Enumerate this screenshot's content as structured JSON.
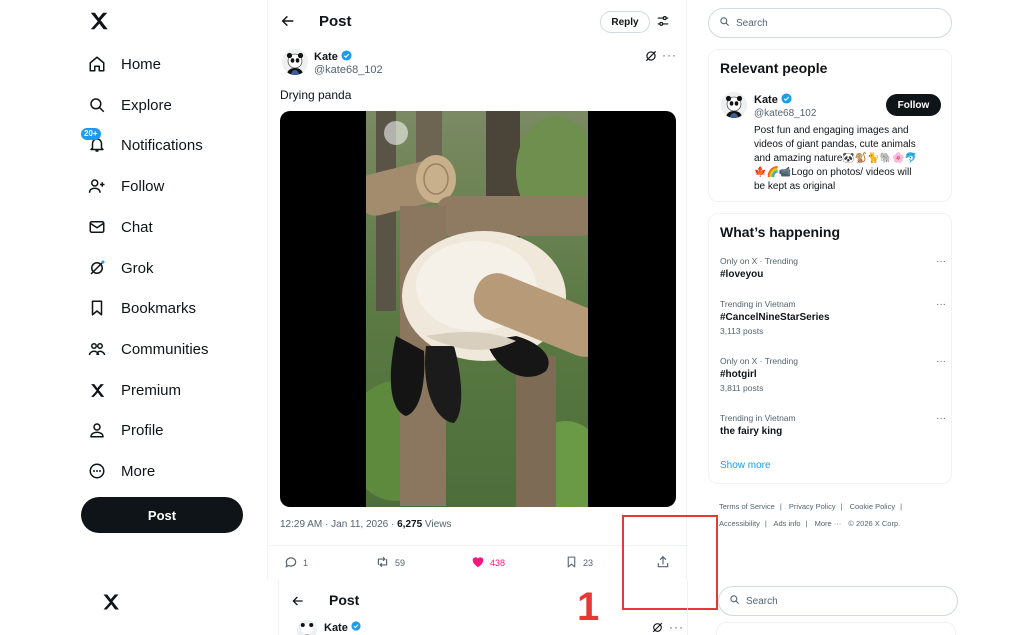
{
  "sidebar": {
    "logo": "x-logo-icon",
    "items": [
      {
        "label": "Home",
        "icon": "home-icon"
      },
      {
        "label": "Explore",
        "icon": "search-icon"
      },
      {
        "label": "Notifications",
        "icon": "bell-icon",
        "badge": "20+"
      },
      {
        "label": "Follow",
        "icon": "add-person-icon"
      },
      {
        "label": "Chat",
        "icon": "mail-icon"
      },
      {
        "label": "Grok",
        "icon": "grok-icon"
      },
      {
        "label": "Bookmarks",
        "icon": "bookmark-icon"
      },
      {
        "label": "Communities",
        "icon": "people-icon"
      },
      {
        "label": "Premium",
        "icon": "x-logo-icon"
      },
      {
        "label": "Profile",
        "icon": "person-icon"
      },
      {
        "label": "More",
        "icon": "more-circle-icon"
      }
    ],
    "post_label": "Post"
  },
  "header": {
    "title": "Post",
    "reply_label": "Reply"
  },
  "post": {
    "author_name": "Kate",
    "author_handle": "@kate68_102",
    "text": "Drying panda",
    "time": "12:29 AM · Jan 11, 2026 · ",
    "views_count": "6,275",
    "views_label": " Views",
    "replies": "1",
    "reposts": "59",
    "likes": "438",
    "bookmarks": "23",
    "more": "···"
  },
  "annotation": {
    "step": "1",
    "color": "#e53935"
  },
  "search": {
    "placeholder": "Search"
  },
  "relevant": {
    "title": "Relevant people",
    "name": "Kate",
    "handle": "@kate68_102",
    "follow_label": "Follow",
    "bio_line1": "Post fun and engaging images and",
    "bio_line2": "videos of giant pandas, cute animals",
    "bio_line3": "and amazing nature🐼🐒🐈🐘🌸🐬",
    "bio_line4": "🍁🌈📹Logo on photos/ videos will",
    "bio_line5": "be kept as original"
  },
  "happening": {
    "title": "What’s happening",
    "trends": [
      {
        "context": "Only on X · Trending",
        "name": "#loveyou",
        "posts": ""
      },
      {
        "context": "Trending in Vietnam",
        "name": "#CancelNineStarSeries",
        "posts": "3,113 posts"
      },
      {
        "context": "Only on X · Trending",
        "name": "#hotgirl",
        "posts": "3,811 posts"
      },
      {
        "context": "Trending in Vietnam",
        "name": "the fairy king",
        "posts": ""
      }
    ],
    "show_more": "Show more"
  },
  "footer": {
    "terms": "Terms of Service",
    "privacy": "Privacy Policy",
    "cookie": "Cookie Policy",
    "accessibility": "Accessibility",
    "ads": "Ads info",
    "more": "More ···",
    "copyright": "© 2026 X Corp.",
    "sep": "|"
  },
  "second": {
    "title": "Post",
    "author_name": "Kate",
    "search_placeholder": "Search"
  },
  "colors": {
    "accent": "#1d9bf0",
    "like": "#f91880",
    "primary_button": "#0f1419"
  }
}
